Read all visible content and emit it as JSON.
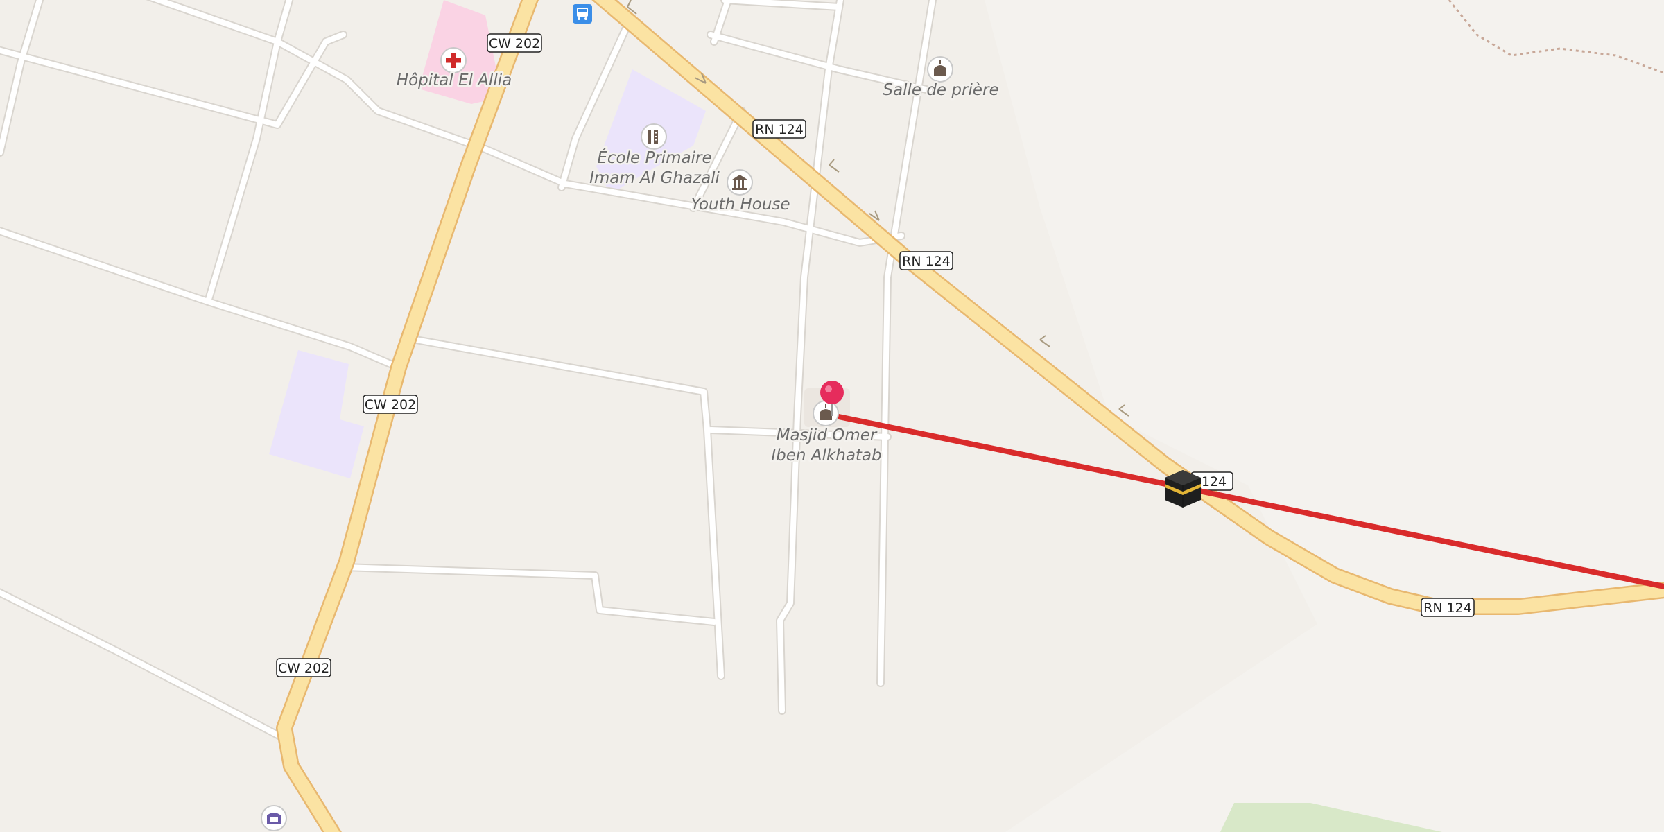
{
  "map": {
    "road_shields": [
      {
        "id": "cw202-top",
        "label": "CW 202"
      },
      {
        "id": "cw202-mid",
        "label": "CW 202"
      },
      {
        "id": "cw202-low",
        "label": "CW 202"
      },
      {
        "id": "rn124-a",
        "label": "RN 124"
      },
      {
        "id": "rn124-b",
        "label": "RN 124"
      },
      {
        "id": "rn124-c",
        "label": "124"
      },
      {
        "id": "rn124-d",
        "label": "RN 124"
      }
    ],
    "pois": [
      {
        "id": "hospital",
        "icon": "hospital-cross-icon",
        "lines": [
          "Hôpital El Allia"
        ]
      },
      {
        "id": "prayer-room",
        "icon": "mosque-icon",
        "lines": [
          "Salle de prière"
        ]
      },
      {
        "id": "school",
        "icon": "school-icon",
        "lines": [
          "École Primaire",
          "Imam Al Ghazali"
        ]
      },
      {
        "id": "youth-house",
        "icon": "townhall-icon",
        "lines": [
          "Youth House"
        ]
      },
      {
        "id": "mosque",
        "icon": "mosque-icon",
        "lines": [
          "Masjid Omer",
          "Iben Alkhatab"
        ]
      }
    ],
    "icons": {
      "bus_stop": "bus-stop-icon",
      "location_pin": "location-pin-icon",
      "kaaba": "kaaba-icon",
      "theatre": "theatre-icon"
    },
    "colors": {
      "background": "#f2efea",
      "main_road": "#fbe3a3",
      "main_road_casing": "#e8b870",
      "minor_road": "#ffffff",
      "minor_road_casing": "#d9d5cf",
      "qibla_line": "#d92b2b",
      "pin": "#e62c5c",
      "hospital_zone": "#fad3e4",
      "school_zone": "#ebe4fb"
    }
  }
}
